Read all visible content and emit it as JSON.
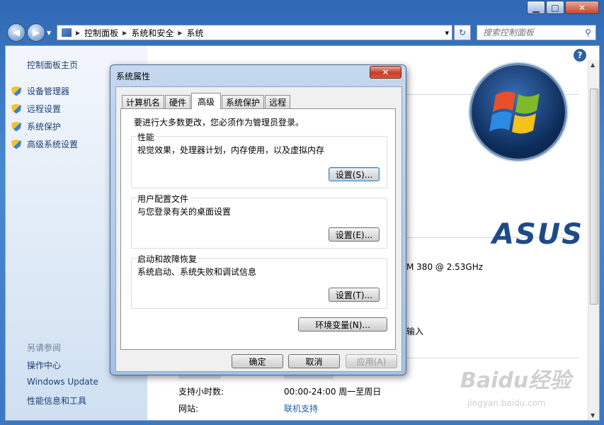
{
  "window": {
    "controls": {
      "minimize": "▁",
      "maximize": "□",
      "close": "✕"
    }
  },
  "address_bar": {
    "crumbs": [
      "控制面板",
      "系统和安全",
      "系统"
    ],
    "dropdown": "▾",
    "refresh": "↻"
  },
  "search": {
    "placeholder": "搜索控制面板"
  },
  "left_pane": {
    "home": "控制面板主页",
    "items": [
      "设备管理器",
      "远程设置",
      "系统保护",
      "高级系统设置"
    ],
    "see_also_title": "另请参阅",
    "see_also": [
      "操作中心",
      "Windows Update",
      "性能信息和工具"
    ]
  },
  "main_pane": {
    "cpu_partial": "M 380  @ 2.53GHz",
    "partial_input": "输入",
    "support_hours_label": "支持小时数:",
    "support_hours_value": "00:00-24:00 周一至周日",
    "website_label": "网站:",
    "website_value": "联机支持",
    "oem_logo": "ASUS",
    "help": "?"
  },
  "dialog": {
    "title": "系统属性",
    "close": "✕",
    "tabs": [
      "计算机名",
      "硬件",
      "高级",
      "系统保护",
      "远程"
    ],
    "active_tab": "高级",
    "admin_note": "要进行大多数更改，您必须作为管理员登录。",
    "performance": {
      "title": "性能",
      "desc": "视觉效果，处理器计划，内存使用，以及虚拟内存",
      "button": "设置(S)..."
    },
    "user_profiles": {
      "title": "用户配置文件",
      "desc": "与您登录有关的桌面设置",
      "button": "设置(E)..."
    },
    "startup": {
      "title": "启动和故障恢复",
      "desc": "系统启动、系统失败和调试信息",
      "button": "设置(T)..."
    },
    "env_button": "环境变量(N)...",
    "ok": "确定",
    "cancel": "取消",
    "apply": "应用(A)"
  },
  "watermark": {
    "main": "Baidu经验",
    "sub": "jingyan.baidu.com"
  },
  "colors": {
    "link": "#1e5bb0",
    "dialog_frame": "#a6c1e3",
    "window_frame": "#3b78c4"
  }
}
